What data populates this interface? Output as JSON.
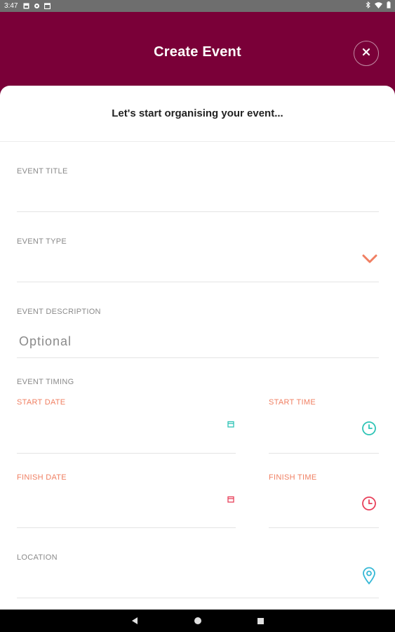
{
  "status_bar": {
    "time": "3:47",
    "left_icons": [
      "image-icon",
      "gear-icon",
      "calendar-icon"
    ],
    "right_icons": [
      "bluetooth-icon",
      "wifi-icon",
      "battery-icon"
    ]
  },
  "header": {
    "title": "Create Event",
    "close_icon": "close-icon",
    "background_color": "#7a0038"
  },
  "form": {
    "subtitle": "Let's start organising your event...",
    "event_title": {
      "label": "EVENT TITLE",
      "value": ""
    },
    "event_type": {
      "label": "EVENT TYPE",
      "value": "",
      "icon": "chevron-down-icon"
    },
    "event_description": {
      "label": "EVENT DESCRIPTION",
      "placeholder": "Optional"
    },
    "event_timing": {
      "label": "EVENT TIMING",
      "start_date": {
        "label": "START DATE",
        "icon": "calendar-icon",
        "icon_color": "#2ec4b6"
      },
      "start_time": {
        "label": "START TIME",
        "icon": "clock-icon",
        "icon_color": "#2ec4b6"
      },
      "finish_date": {
        "label": "FINISH DATE",
        "icon": "calendar-icon",
        "icon_color": "#e8405a"
      },
      "finish_time": {
        "label": "FINISH TIME",
        "icon": "clock-icon",
        "icon_color": "#e8405a"
      }
    },
    "location": {
      "label": "LOCATION",
      "icon": "location-pin-icon",
      "icon_color": "#35b8d6"
    }
  },
  "colors": {
    "accent_orange": "#f07f62",
    "label_gray": "#8a8a8a"
  },
  "nav_bar": {
    "buttons": [
      "back-icon",
      "home-icon",
      "recents-icon"
    ]
  }
}
